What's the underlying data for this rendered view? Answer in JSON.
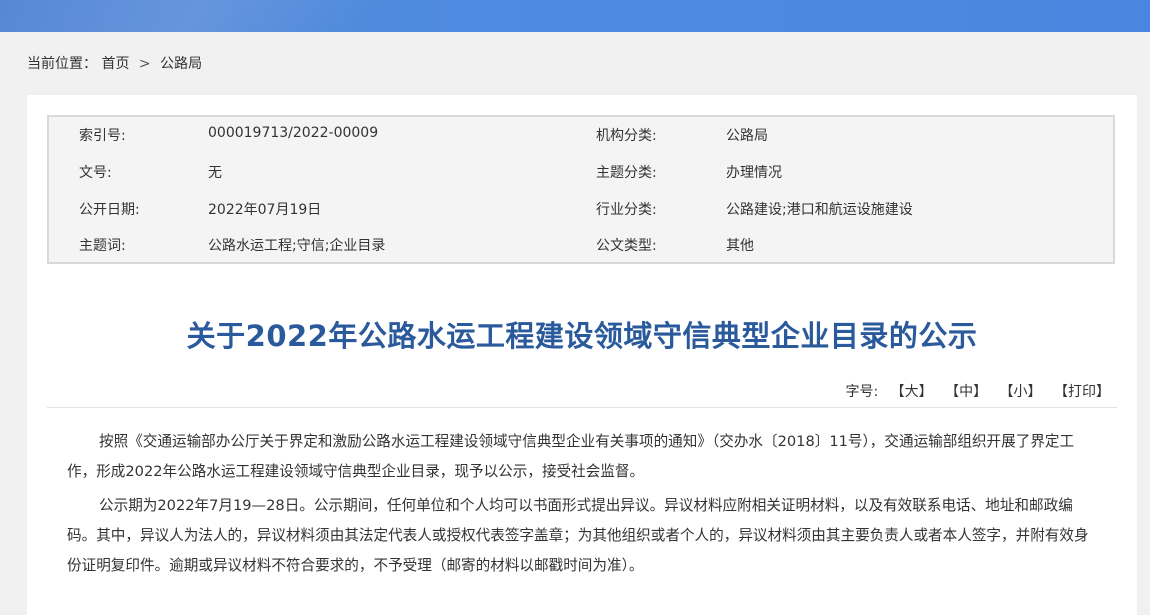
{
  "breadcrumb": {
    "prefix": "当前位置：",
    "home": "首页",
    "separator": ">",
    "current": "公路局"
  },
  "meta": [
    {
      "label1": "索引号:",
      "value1": "000019713/2022-00009",
      "label2": "机构分类:",
      "value2": "公路局"
    },
    {
      "label1": "文号:",
      "value1": "无",
      "label2": "主题分类:",
      "value2": "办理情况"
    },
    {
      "label1": "公开日期:",
      "value1": "2022年07月19日",
      "label2": "行业分类:",
      "value2": "公路建设;港口和航运设施建设"
    },
    {
      "label1": "主题词:",
      "value1": "公路水运工程;守信;企业目录",
      "label2": "公文类型:",
      "value2": "其他"
    }
  ],
  "title": "关于2022年公路水运工程建设领域守信典型企业目录的公示",
  "font_controls": {
    "label": "字号:",
    "large": "【大】",
    "medium": "【中】",
    "small": "【小】",
    "print": "【打印】"
  },
  "paragraphs": [
    "按照《交通运输部办公厅关于界定和激励公路水运工程建设领域守信典型企业有关事项的通知》（交办水〔2018〕11号），交通运输部组织开展了界定工作，形成2022年公路水运工程建设领域守信典型企业目录，现予以公示，接受社会监督。",
    "公示期为2022年7月19—28日。公示期间，任何单位和个人均可以书面形式提出异议。异议材料应附相关证明材料，以及有效联系电话、地址和邮政编码。其中，异议人为法人的，异议材料须由其法定代表人或授权代表签字盖章；为其他组织或者个人的，异议材料须由其主要负责人或者本人签字，并附有效身份证明复印件。逾期或异议材料不符合要求的，不予受理（邮寄的材料以邮戳时间为准）。"
  ]
}
